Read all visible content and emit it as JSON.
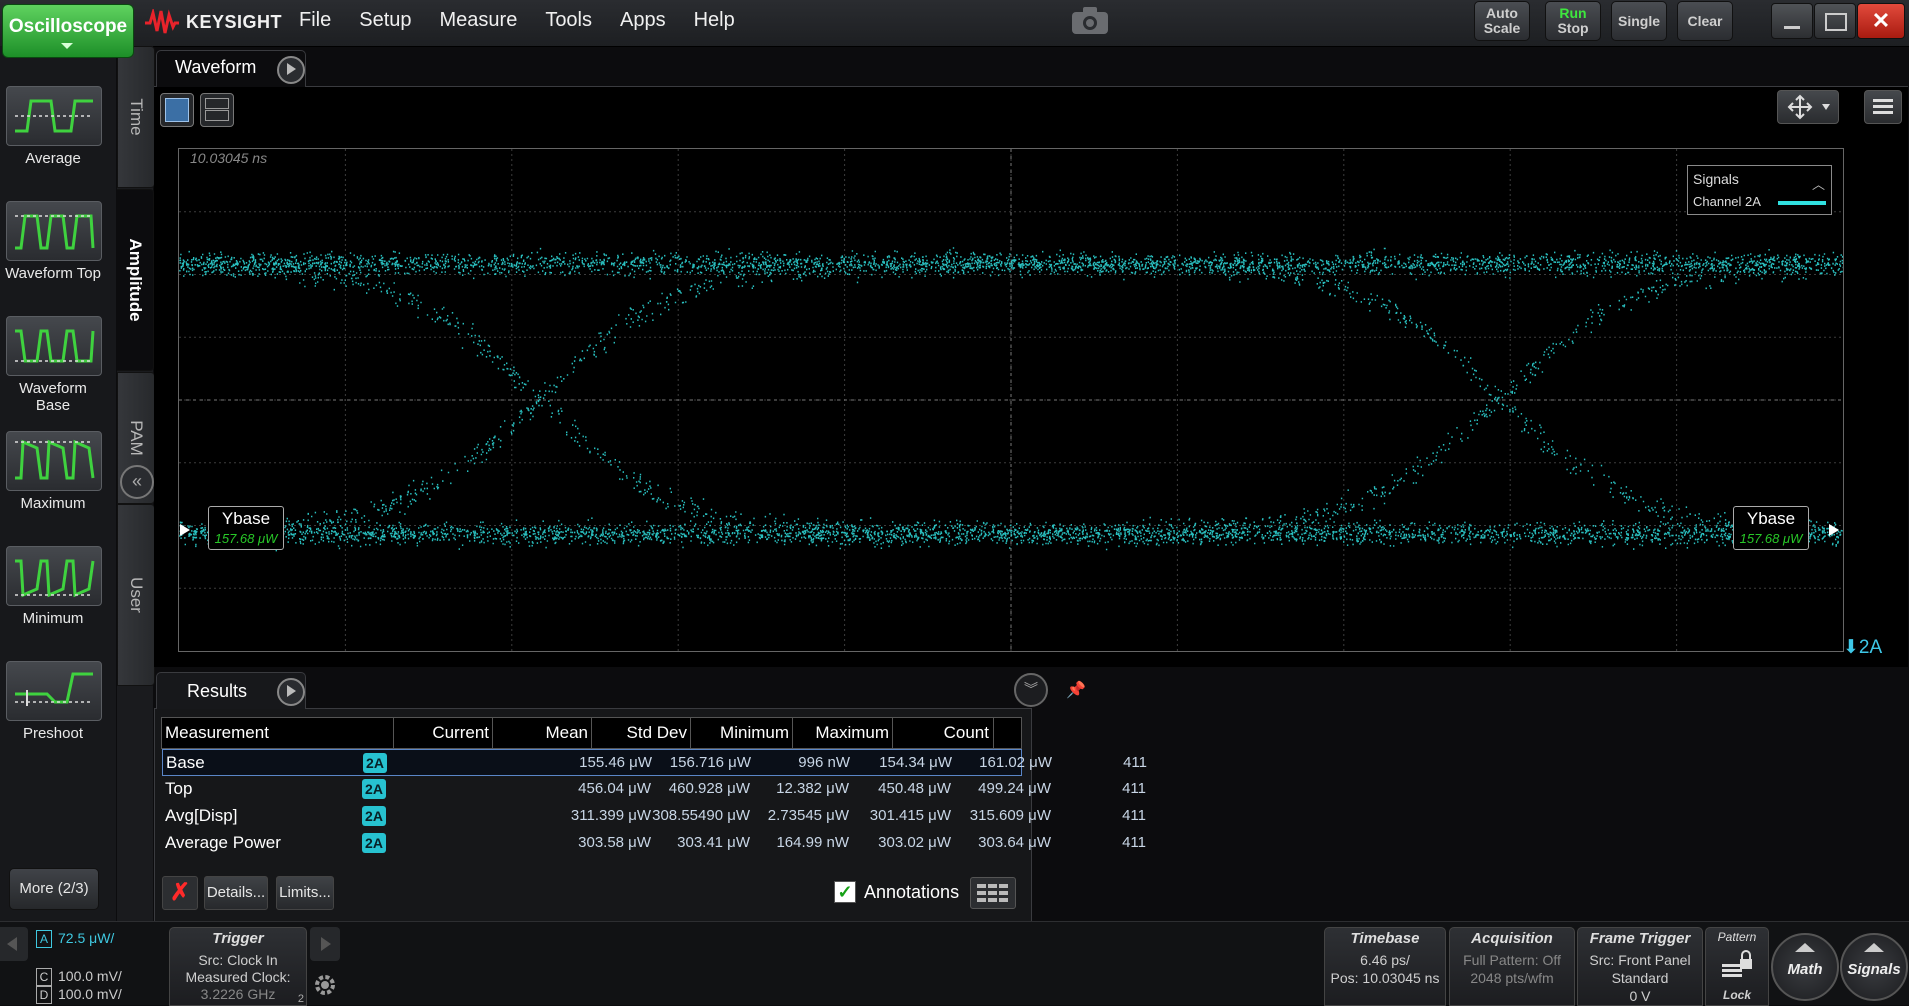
{
  "app": {
    "mode_button": "Oscilloscope",
    "brand": "KEYSIGHT"
  },
  "menu": [
    "File",
    "Setup",
    "Measure",
    "Tools",
    "Apps",
    "Help"
  ],
  "toolbar": {
    "auto_scale": [
      "Auto",
      "Scale"
    ],
    "run_stop": [
      "Run",
      "Stop"
    ],
    "single": "Single",
    "clear": "Clear",
    "close": "✕"
  },
  "measurement_palette": {
    "items": [
      {
        "label": "Average",
        "icon": "average-icon"
      },
      {
        "label": "Waveform Top",
        "icon": "waveform-top-icon"
      },
      {
        "label": "Waveform Base",
        "icon": "waveform-base-icon"
      },
      {
        "label": "Maximum",
        "icon": "maximum-icon"
      },
      {
        "label": "Minimum",
        "icon": "minimum-icon"
      },
      {
        "label": "Preshoot",
        "icon": "preshoot-icon"
      }
    ],
    "more": "More (2/3)"
  },
  "vertical_tabs": [
    "Time",
    "Amplitude",
    "PAM",
    "User"
  ],
  "waveform": {
    "tab_label": "Waveform",
    "time_reference": "10.03045 ns",
    "signals_title": "Signals",
    "signal_channel": "Channel 2A",
    "trace_color": "#30e0e0",
    "marker_name": "Ybase",
    "marker_value": "157.68 μW",
    "channel_marker": "2A"
  },
  "results": {
    "tab_label": "Results",
    "columns": [
      "Measurement",
      "Current",
      "Mean",
      "Std Dev",
      "Minimum",
      "Maximum",
      "Count"
    ],
    "rows": [
      {
        "name": "Base",
        "src": "2A",
        "current": "155.46 μW",
        "mean": "156.716 μW",
        "std": "996 nW",
        "min": "154.34 μW",
        "max": "161.02 μW",
        "count": "411"
      },
      {
        "name": "Top",
        "src": "2A",
        "current": "456.04 μW",
        "mean": "460.928 μW",
        "std": "12.382 μW",
        "min": "450.48 μW",
        "max": "499.24 μW",
        "count": "411"
      },
      {
        "name": "Avg[Disp]",
        "src": "2A",
        "current": "311.399 μW",
        "mean": "308.55490 μW",
        "std": "2.73545 μW",
        "min": "301.415 μW",
        "max": "315.609 μW",
        "count": "411"
      },
      {
        "name": "Average Power",
        "src": "2A",
        "current": "303.58 μW",
        "mean": "303.41 μW",
        "std": "164.99 nW",
        "min": "303.02 μW",
        "max": "303.64 μW",
        "count": "411"
      }
    ],
    "details": "Details...",
    "limits": "Limits...",
    "annotations": "Annotations",
    "annotations_checked": true
  },
  "status": {
    "channel_a": "72.5 μW/",
    "channel_c": "100.0 mV/",
    "channel_d": "100.0 mV/",
    "trigger": {
      "title": "Trigger",
      "line1": "Src: Clock In",
      "line2": "Measured Clock:",
      "line3": "3.2226 GHz",
      "badge": "2"
    },
    "timebase": {
      "title": "Timebase",
      "line1": "6.46 ps/",
      "line2": "Pos: 10.03045 ns"
    },
    "acquisition": {
      "title": "Acquisition",
      "line1": "Full Pattern: Off",
      "line2": "2048 pts/wfm"
    },
    "frame_trigger": {
      "title": "Frame Trigger",
      "line1": "Src: Front Panel",
      "line2": "Standard",
      "line3": "0 V"
    },
    "pattern": {
      "title": "Pattern",
      "lock": "Lock"
    },
    "math": "Math",
    "signals": "Signals"
  }
}
